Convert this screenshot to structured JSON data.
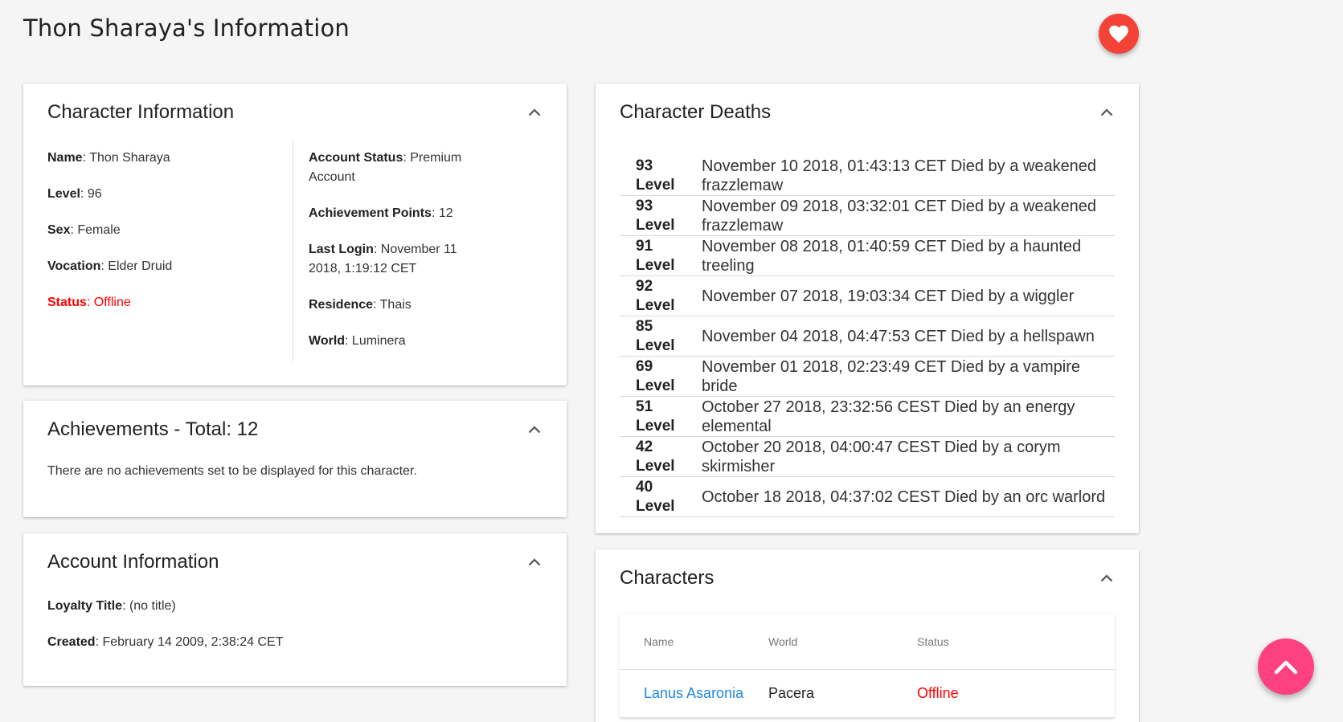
{
  "page": {
    "title": "Thon Sharaya's Information"
  },
  "colors": {
    "favorite": "#f44336",
    "scroll_top": "#ff4081",
    "link": "#1e88e5",
    "offline": "#ff0000"
  },
  "icons": {
    "favorite": "heart-icon",
    "collapse": "chevron-up-icon",
    "scroll_top": "chevron-up-icon"
  },
  "character_info": {
    "title": "Character Information",
    "left": [
      {
        "label": "Name",
        "value": "Thon Sharaya"
      },
      {
        "label": "Level",
        "value": "96"
      },
      {
        "label": "Sex",
        "value": "Female"
      },
      {
        "label": "Vocation",
        "value": "Elder Druid"
      },
      {
        "label": "Status",
        "value": "Offline"
      }
    ],
    "right": [
      {
        "label": "Account Status",
        "value": "Premium Account"
      },
      {
        "label": "Achievement Points",
        "value": "12"
      },
      {
        "label": "Last Login",
        "value": "November 11 2018, 1:19:12 CET"
      },
      {
        "label": "Residence",
        "value": "Thais"
      },
      {
        "label": "World",
        "value": "Luminera"
      }
    ]
  },
  "achievements": {
    "title": "Achievements - Total: 12",
    "text": "There are no achievements set to be displayed for this character."
  },
  "account_info": {
    "title": "Account Information",
    "items": [
      {
        "label": "Loyalty Title",
        "value": "(no title)"
      },
      {
        "label": "Created",
        "value": "February 14 2009, 2:38:24 CET"
      }
    ]
  },
  "deaths": {
    "title": "Character Deaths",
    "level_word": "Level",
    "rows": [
      {
        "level": "93",
        "text": "November 10 2018, 01:43:13 CET Died by a weakened frazzlemaw"
      },
      {
        "level": "93",
        "text": "November 09 2018, 03:32:01 CET Died by a weakened frazzlemaw"
      },
      {
        "level": "91",
        "text": "November 08 2018, 01:40:59 CET Died by a haunted treeling"
      },
      {
        "level": "92",
        "text": "November 07 2018, 19:03:34 CET Died by a wiggler"
      },
      {
        "level": "85",
        "text": "November 04 2018, 04:47:53 CET Died by a hellspawn"
      },
      {
        "level": "69",
        "text": "November 01 2018, 02:23:49 CET Died by a vampire bride"
      },
      {
        "level": "51",
        "text": "October 27 2018, 23:32:56 CEST Died by an energy elemental"
      },
      {
        "level": "42",
        "text": "October 20 2018, 04:00:47 CEST Died by a corym skirmisher"
      },
      {
        "level": "40",
        "text": "October 18 2018, 04:37:02 CEST Died by an orc warlord"
      }
    ]
  },
  "characters": {
    "title": "Characters",
    "columns": [
      "Name",
      "World",
      "Status"
    ],
    "rows": [
      {
        "name": "Lanus Asaronia",
        "world": "Pacera",
        "status": "Offline"
      }
    ]
  }
}
